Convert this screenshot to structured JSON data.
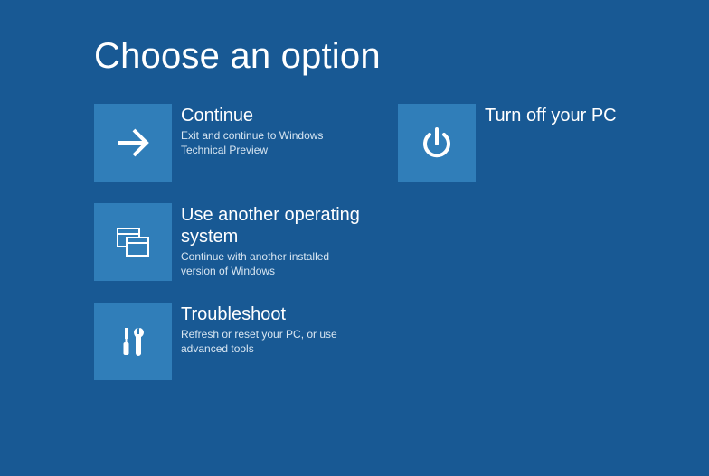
{
  "title": "Choose an option",
  "options": {
    "continue": {
      "title": "Continue",
      "desc": "Exit and continue to Windows Technical Preview"
    },
    "other_os": {
      "title": "Use another operating system",
      "desc": "Continue with another installed version of Windows"
    },
    "troubleshoot": {
      "title": "Troubleshoot",
      "desc": "Refresh or reset your PC, or use advanced tools"
    },
    "turn_off": {
      "title": "Turn off your PC",
      "desc": ""
    }
  }
}
